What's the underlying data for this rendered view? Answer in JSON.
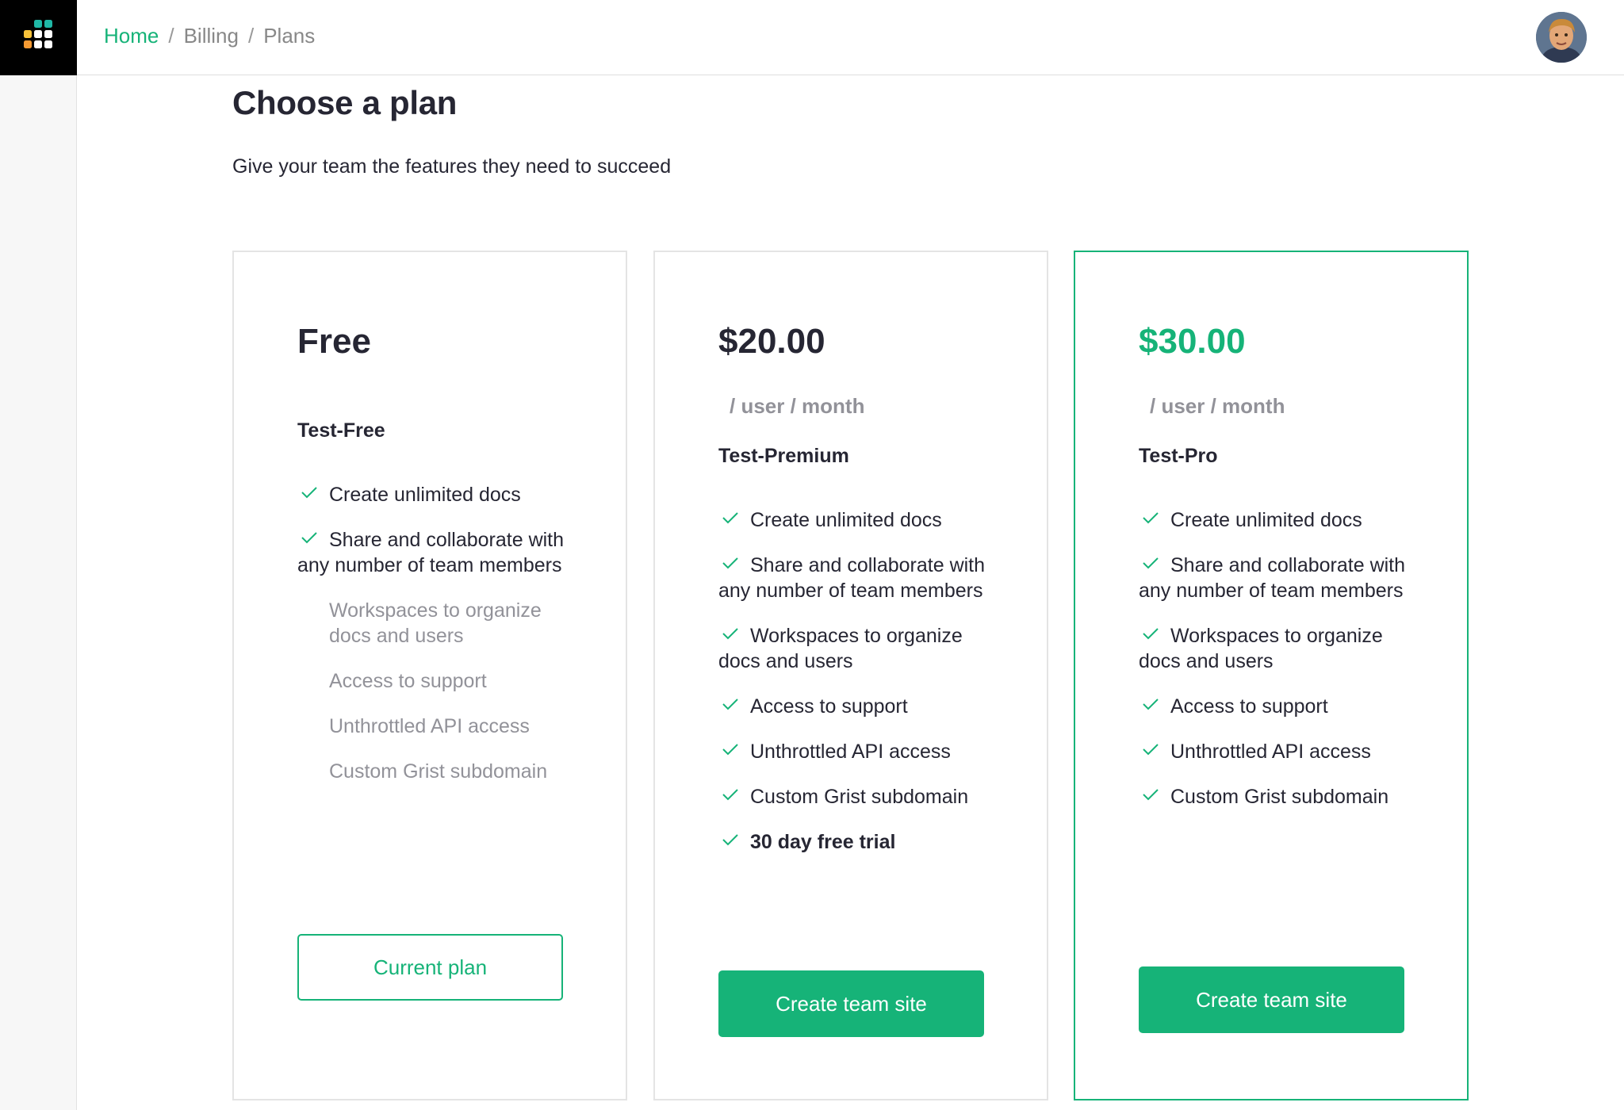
{
  "nav": {
    "breadcrumb": [
      "Home",
      "Billing",
      "Plans"
    ],
    "separator": "/"
  },
  "page": {
    "title": "Choose a plan",
    "subtitle": "Give your team the features they need to succeed"
  },
  "plans": [
    {
      "price": "Free",
      "interval": "",
      "name": "Test-Free",
      "selected": false,
      "features": [
        {
          "text": "Create unlimited docs",
          "included": true
        },
        {
          "text": "Share and collaborate with any number of team members",
          "included": true
        },
        {
          "text": "Workspaces to organize docs and users",
          "included": false
        },
        {
          "text": "Access to support",
          "included": false
        },
        {
          "text": "Unthrottled API access",
          "included": false
        },
        {
          "text": "Custom Grist subdomain",
          "included": false
        }
      ],
      "button_label": "Current plan"
    },
    {
      "price": "$20.00",
      "interval": "/ user / month",
      "name": "Test-Premium",
      "selected": false,
      "features": [
        {
          "text": "Create unlimited docs",
          "included": true
        },
        {
          "text": "Share and collaborate with any number of team members",
          "included": true
        },
        {
          "text": "Workspaces to organize docs and users",
          "included": true
        },
        {
          "text": "Access to support",
          "included": true
        },
        {
          "text": "Unthrottled API access",
          "included": true
        },
        {
          "text": "Custom Grist subdomain",
          "included": true
        },
        {
          "text": "30 day free trial",
          "included": true
        }
      ],
      "button_label": "Create team site"
    },
    {
      "price": "$30.00",
      "interval": "/ user / month",
      "name": "Test-Pro",
      "selected": true,
      "features": [
        {
          "text": "Create unlimited docs",
          "included": true
        },
        {
          "text": "Share and collaborate with any number of team members",
          "included": true
        },
        {
          "text": "Workspaces to organize docs and users",
          "included": true
        },
        {
          "text": "Access to support",
          "included": true
        },
        {
          "text": "Unthrottled API access",
          "included": true
        },
        {
          "text": "Custom Grist subdomain",
          "included": true
        }
      ],
      "button_label": "Create team site"
    }
  ],
  "colors": {
    "accent": "#16b378",
    "text": "#262633",
    "muted": "#929299",
    "border": "#e4e4e4"
  },
  "icons": {
    "logo": "grist-logo-icon",
    "check": "check-icon",
    "avatar": "user-avatar"
  }
}
